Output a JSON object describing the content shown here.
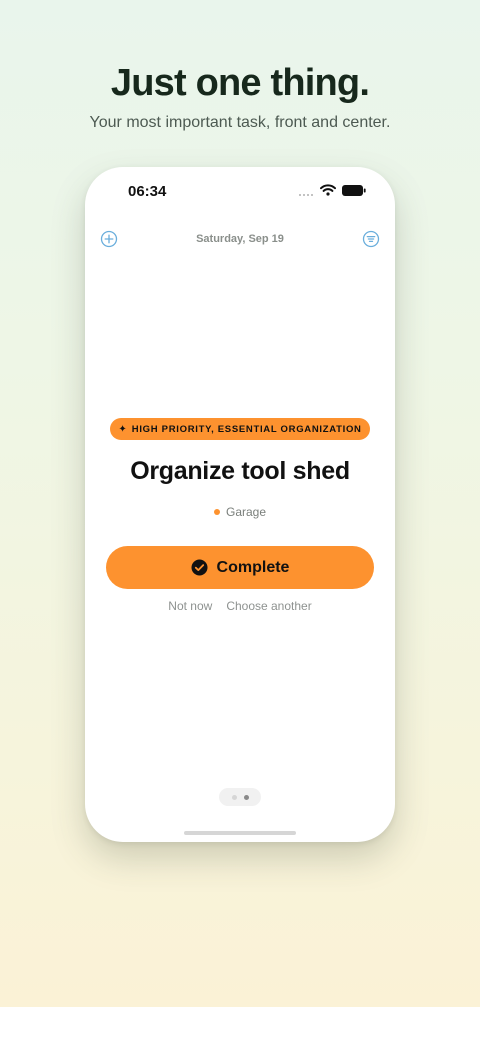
{
  "headline": "Just one thing.",
  "subhead": "Your most important task, front and center.",
  "status_bar": {
    "time": "06:34"
  },
  "header": {
    "date": "Saturday, Sep 19",
    "add_icon": "plus-circle-icon",
    "filter_icon": "filter-lines-icon"
  },
  "task": {
    "priority_badge": "HIGH PRIORITY, ESSENTIAL ORGANIZATION",
    "title": "Organize tool shed",
    "category": "Garage",
    "category_color": "#fd922f"
  },
  "actions": {
    "complete_label": "Complete",
    "not_now_label": "Not now",
    "choose_another_label": "Choose another"
  },
  "pager": {
    "pages": 2,
    "active_index": 1
  },
  "colors": {
    "accent": "#fd922f",
    "icon_blue": "#6aaedc",
    "headline": "#17281c"
  }
}
